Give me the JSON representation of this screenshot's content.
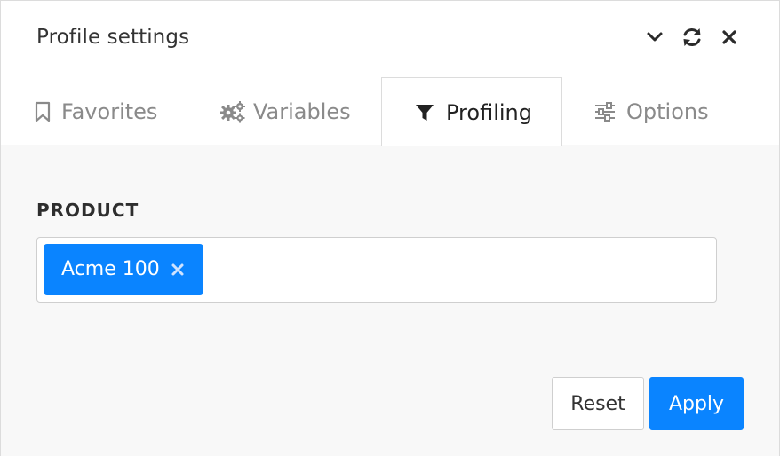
{
  "header": {
    "title": "Profile settings",
    "icons": [
      "chevron-down-icon",
      "refresh-icon",
      "close-icon"
    ]
  },
  "tabs": [
    {
      "label": "Favorites",
      "icon": "bookmark-icon",
      "active": false
    },
    {
      "label": "Variables",
      "icon": "gears-icon",
      "active": false
    },
    {
      "label": "Profiling",
      "icon": "filter-icon",
      "active": true
    },
    {
      "label": "Options",
      "icon": "sliders-icon",
      "active": false
    }
  ],
  "profiling": {
    "field_label": "PRODUCT",
    "selected": [
      {
        "label": "Acme 100"
      }
    ]
  },
  "actions": {
    "reset_label": "Reset",
    "apply_label": "Apply"
  },
  "colors": {
    "accent": "#0a84ff",
    "text_primary": "#222222",
    "text_muted": "#8a8a8a",
    "border": "#dcdcdc",
    "content_bg": "#f8f8f8"
  }
}
